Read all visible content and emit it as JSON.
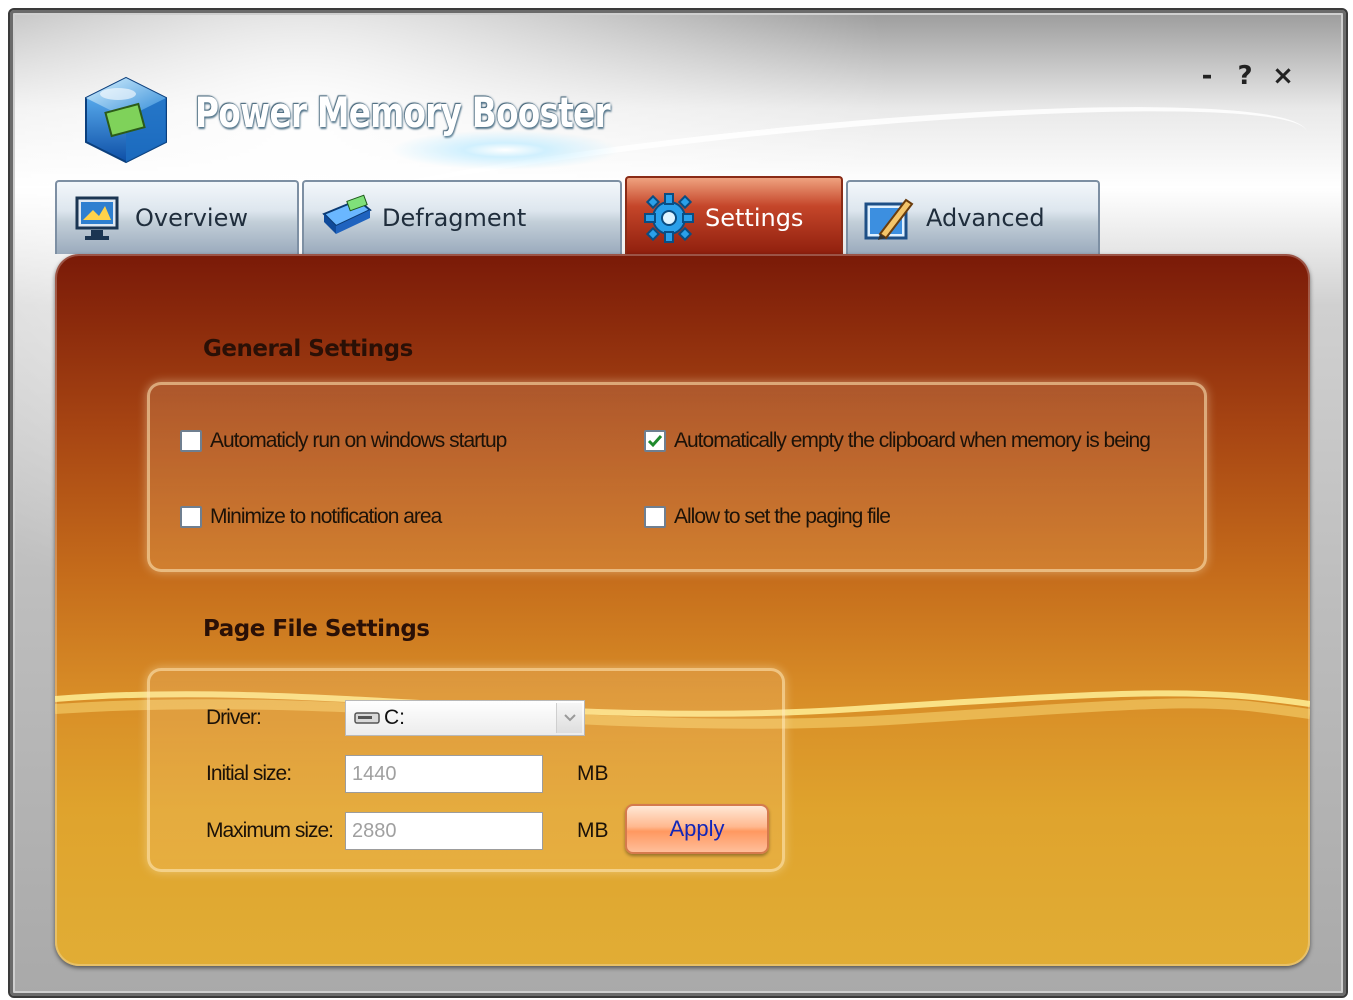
{
  "app": {
    "title": "Power Memory Booster"
  },
  "window_controls": {
    "minimize": "-",
    "help": "?",
    "close": "×"
  },
  "tabs": [
    {
      "label": "Overview",
      "icon": "monitor-icon",
      "active": false
    },
    {
      "label": "Defragment",
      "icon": "memory-module-icon",
      "active": false
    },
    {
      "label": "Settings",
      "icon": "gear-icon",
      "active": true
    },
    {
      "label": "Advanced",
      "icon": "pen-tool-icon",
      "active": false
    }
  ],
  "general_settings": {
    "title": "General Settings",
    "options": [
      {
        "label": "Automaticly run on windows startup",
        "checked": false
      },
      {
        "label": "Automatically empty the clipboard when memory is being",
        "checked": true
      },
      {
        "label": "Minimize to notification area",
        "checked": false
      },
      {
        "label": "Allow to set the paging file",
        "checked": false
      }
    ]
  },
  "page_file_settings": {
    "title": "Page File Settings",
    "driver_label": "Driver:",
    "driver_value": "C:",
    "initial_label": "Initial size:",
    "initial_value": "1440",
    "initial_unit": "MB",
    "maximum_label": "Maximum size:",
    "maximum_value": "2880",
    "maximum_unit": "MB",
    "apply_label": "Apply"
  },
  "colors": {
    "panel_top": "#7a1a08",
    "panel_bottom": "#e1ad35",
    "active_tab": "#c5462a",
    "apply_text": "#1226b8"
  }
}
